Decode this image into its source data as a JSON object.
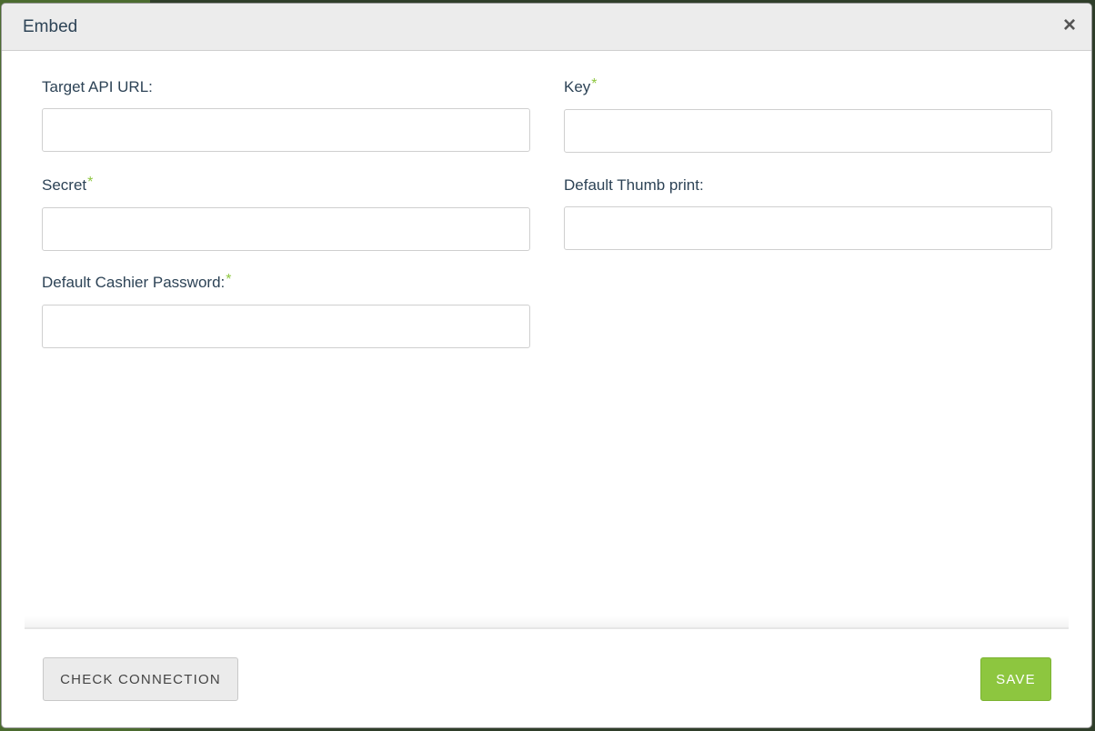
{
  "modal": {
    "title": "Embed",
    "close_symbol": "×"
  },
  "fields": {
    "target_api_url": {
      "label": "Target API URL:",
      "value": "",
      "required": false
    },
    "key": {
      "label": "Key",
      "value": "",
      "required": true
    },
    "secret": {
      "label": "Secret",
      "value": "",
      "required": true
    },
    "default_thumb_print": {
      "label": "Default Thumb print:",
      "value": "",
      "required": false
    },
    "default_cashier_password": {
      "label": "Default Cashier Password:",
      "value": "",
      "required": true
    }
  },
  "required_marker": "*",
  "footer": {
    "check_connection_label": "CHECK CONNECTION",
    "save_label": "SAVE"
  },
  "icons": {
    "close": "close-icon"
  },
  "colors": {
    "accent_green": "#8dc63f",
    "label_text": "#2d4356",
    "header_bg": "#ececec"
  }
}
